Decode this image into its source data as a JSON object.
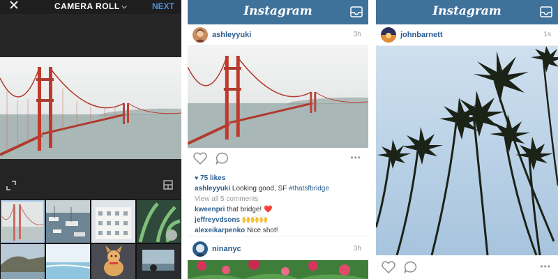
{
  "camera_roll": {
    "title": "CAMERA ROLL",
    "next_label": "NEXT",
    "close_icon": "close-icon",
    "dropdown_icon": "chevron-down-icon"
  },
  "feed_left": {
    "logo": "Instagram",
    "post1": {
      "username": "ashleyyuki",
      "time": "3h",
      "likes": "75 likes",
      "caption_user": "ashleyyuki",
      "caption_text": " Looking good, SF ",
      "hashtag": "#thatsfbridge",
      "view_all": "View all 5 comments",
      "comments": [
        {
          "user": "kweenpri",
          "text": " that bridge! ❤️"
        },
        {
          "user": "jeffreyvdsons",
          "text": " 🙌🙌🙌"
        },
        {
          "user": "alexeikarpenko",
          "text": " Nice shot!"
        }
      ]
    },
    "post2": {
      "username": "ninanyc",
      "time": "3h"
    }
  },
  "feed_right": {
    "logo": "Instagram",
    "post1": {
      "username": "johnbarnett",
      "time": "1s"
    }
  },
  "colors": {
    "brand": "#3f729b",
    "link": "#2b5f8f",
    "camera_bg": "#222222",
    "next": "#4f8fd6"
  }
}
